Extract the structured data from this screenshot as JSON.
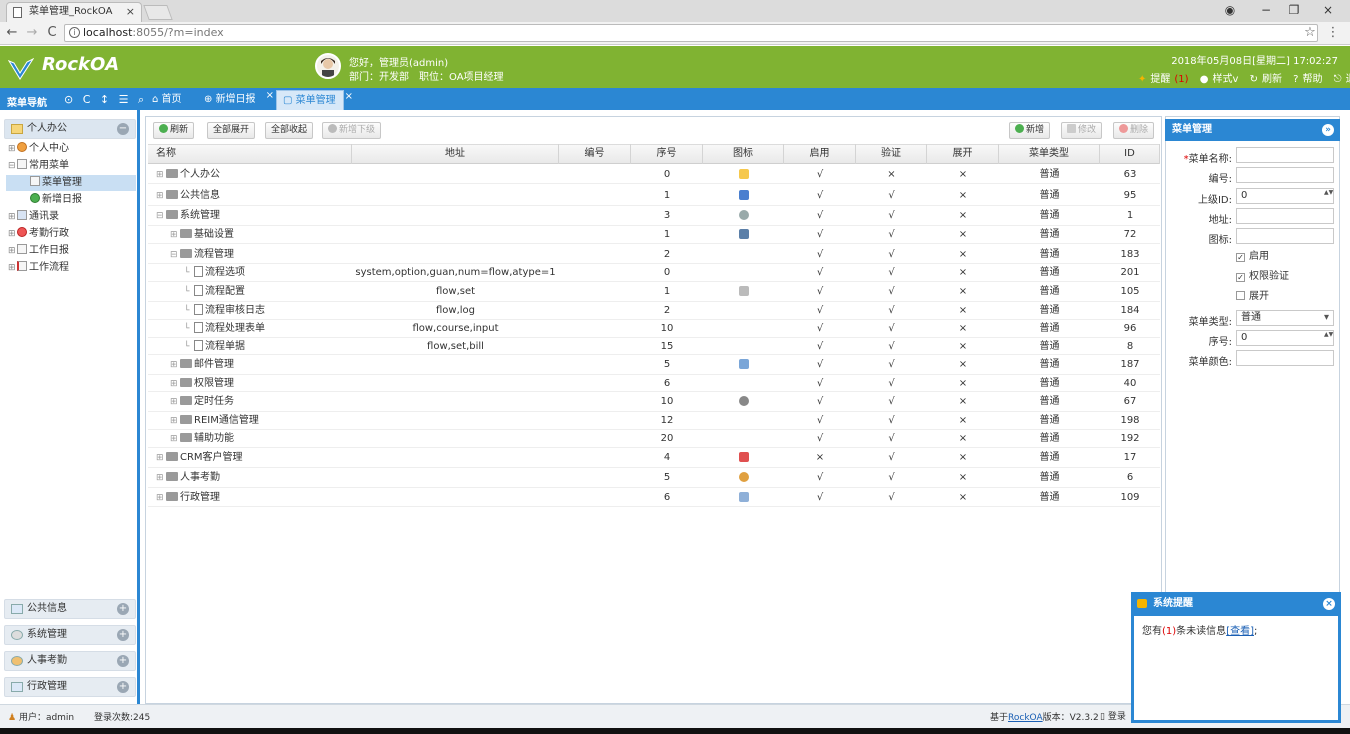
{
  "browser": {
    "tab_title": "菜单管理_RockOA",
    "tab_close": "×",
    "url_host": "localhost",
    "url_rest": ":8055/?m=index",
    "win_min": "−",
    "win_max": "❐",
    "win_close": "×",
    "back": "←",
    "forward": "→",
    "reload": "C",
    "star": "☆",
    "menu": "⋮",
    "account": "◉"
  },
  "header": {
    "logo": "RockOA",
    "greeting": "您好，管理员(admin)",
    "dept": "部门：开发部　职位：OA项目经理",
    "datetime": "2018年05月08日[星期二] 17:02:27",
    "remind": "提醒",
    "remind_count": "(1)",
    "style": "样式v",
    "refresh": "刷新",
    "help": "帮助",
    "logout": "退出"
  },
  "nav": {
    "title": "菜单导航",
    "icons": "⊙ C ↕ ☰ ⌕"
  },
  "tabs": [
    {
      "label": "首页",
      "close": ""
    },
    {
      "label": "新增日报",
      "close": "×"
    },
    {
      "label": "菜单管理",
      "close": "×"
    }
  ],
  "sidebar": {
    "group_top": "个人办公",
    "group_top_btn": "−",
    "tree": [
      {
        "label": "个人中心"
      },
      {
        "label": "常用菜单"
      },
      {
        "label": "菜单管理"
      },
      {
        "label": "新增日报"
      },
      {
        "label": "通讯录"
      },
      {
        "label": "考勤行政"
      },
      {
        "label": "工作日报"
      },
      {
        "label": "工作流程"
      }
    ],
    "groups": [
      {
        "label": "公共信息",
        "btn": "+"
      },
      {
        "label": "系统管理",
        "btn": "+"
      },
      {
        "label": "人事考勤",
        "btn": "+"
      },
      {
        "label": "行政管理",
        "btn": "+"
      }
    ]
  },
  "toolbar": {
    "refresh": "刷新",
    "expand_all": "全部展开",
    "collapse_all": "全部收起",
    "add_child": "新增下级",
    "add": "新增",
    "edit": "修改",
    "delete": "删除"
  },
  "grid": {
    "columns": [
      "名称",
      "地址",
      "编号",
      "序号",
      "图标",
      "启用",
      "验证",
      "展开",
      "菜单类型",
      "ID"
    ],
    "rows": [
      {
        "name": "个人办公",
        "addr": "",
        "num": "",
        "sort": "0",
        "enable": "√",
        "verify": "×",
        "expand": "×",
        "type": "普通",
        "id": "63"
      },
      {
        "name": "公共信息",
        "addr": "",
        "num": "",
        "sort": "1",
        "enable": "√",
        "verify": "√",
        "expand": "×",
        "type": "普通",
        "id": "95"
      },
      {
        "name": "系统管理",
        "addr": "",
        "num": "",
        "sort": "3",
        "enable": "√",
        "verify": "√",
        "expand": "×",
        "type": "普通",
        "id": "1"
      },
      {
        "name": "基础设置",
        "addr": "",
        "num": "",
        "sort": "1",
        "enable": "√",
        "verify": "√",
        "expand": "×",
        "type": "普通",
        "id": "72"
      },
      {
        "name": "流程管理",
        "addr": "",
        "num": "",
        "sort": "2",
        "enable": "√",
        "verify": "√",
        "expand": "×",
        "type": "普通",
        "id": "183"
      },
      {
        "name": "流程选项",
        "addr": "system,option,guan,num=flow,atype=1",
        "num": "",
        "sort": "0",
        "enable": "√",
        "verify": "√",
        "expand": "×",
        "type": "普通",
        "id": "201"
      },
      {
        "name": "流程配置",
        "addr": "flow,set",
        "num": "",
        "sort": "1",
        "enable": "√",
        "verify": "√",
        "expand": "×",
        "type": "普通",
        "id": "105"
      },
      {
        "name": "流程审核日志",
        "addr": "flow,log",
        "num": "",
        "sort": "2",
        "enable": "√",
        "verify": "√",
        "expand": "×",
        "type": "普通",
        "id": "184"
      },
      {
        "name": "流程处理表单",
        "addr": "flow,course,input",
        "num": "",
        "sort": "10",
        "enable": "√",
        "verify": "√",
        "expand": "×",
        "type": "普通",
        "id": "96"
      },
      {
        "name": "流程单据",
        "addr": "flow,set,bill",
        "num": "",
        "sort": "15",
        "enable": "√",
        "verify": "√",
        "expand": "×",
        "type": "普通",
        "id": "8"
      },
      {
        "name": "邮件管理",
        "addr": "",
        "num": "",
        "sort": "5",
        "enable": "√",
        "verify": "√",
        "expand": "×",
        "type": "普通",
        "id": "187"
      },
      {
        "name": "权限管理",
        "addr": "",
        "num": "",
        "sort": "6",
        "enable": "√",
        "verify": "√",
        "expand": "×",
        "type": "普通",
        "id": "40"
      },
      {
        "name": "定时任务",
        "addr": "",
        "num": "",
        "sort": "10",
        "enable": "√",
        "verify": "√",
        "expand": "×",
        "type": "普通",
        "id": "67"
      },
      {
        "name": "REIM通信管理",
        "addr": "",
        "num": "",
        "sort": "12",
        "enable": "√",
        "verify": "√",
        "expand": "×",
        "type": "普通",
        "id": "198"
      },
      {
        "name": "辅助功能",
        "addr": "",
        "num": "",
        "sort": "20",
        "enable": "√",
        "verify": "√",
        "expand": "×",
        "type": "普通",
        "id": "192"
      },
      {
        "name": "CRM客户管理",
        "addr": "",
        "num": "",
        "sort": "4",
        "enable": "×",
        "verify": "√",
        "expand": "×",
        "type": "普通",
        "id": "17"
      },
      {
        "name": "人事考勤",
        "addr": "",
        "num": "",
        "sort": "5",
        "enable": "√",
        "verify": "√",
        "expand": "×",
        "type": "普通",
        "id": "6"
      },
      {
        "name": "行政管理",
        "addr": "",
        "num": "",
        "sort": "6",
        "enable": "√",
        "verify": "√",
        "expand": "×",
        "type": "普通",
        "id": "109"
      }
    ]
  },
  "form": {
    "title": "菜单管理",
    "close": "»",
    "name_req": "*",
    "name_label": "菜单名称:",
    "num_label": "编号:",
    "parent_label": "上级ID:",
    "parent_value": "0",
    "addr_label": "地址:",
    "icon_label": "图标:",
    "enable_label": "启用",
    "verify_label": "权限验证",
    "expand_label": "展开",
    "check": "✓",
    "type_label": "菜单类型:",
    "type_value": "普通",
    "sort_label": "序号:",
    "sort_value": "0",
    "color_label": "菜单颜色:",
    "spin": "▲▼",
    "dropdown": "▾"
  },
  "notify": {
    "title": "系统提醒",
    "close": "×",
    "text_pre": "您有",
    "count": "(1)",
    "text_mid": "条未读信息",
    "link": "[查看]",
    "text_end": ";"
  },
  "status": {
    "user": "用户：admin",
    "login_count": "登录次数:245",
    "based_on": "基于",
    "product": "RockOA",
    "version": "版本：V2.3.2",
    "login": "登录"
  }
}
